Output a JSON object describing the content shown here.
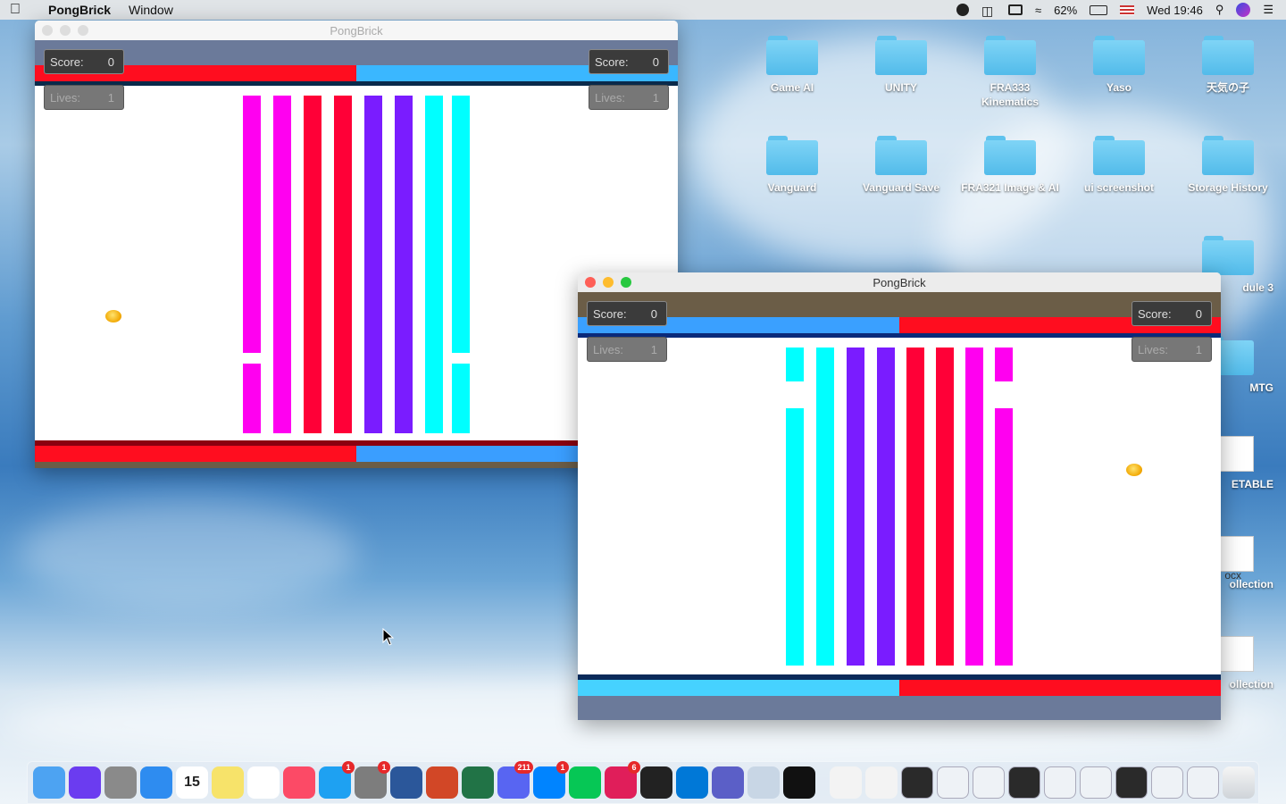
{
  "menubar": {
    "app_name": "PongBrick",
    "menus": [
      "Window"
    ],
    "battery": "62%",
    "clock": "Wed 19:46"
  },
  "desktop_icons": [
    {
      "label": "Game AI",
      "kind": "folder"
    },
    {
      "label": "UNITY",
      "kind": "folder"
    },
    {
      "label": "FRA333 Kinematics",
      "kind": "folder"
    },
    {
      "label": "Yaso",
      "kind": "folder"
    },
    {
      "label": "天気の子",
      "kind": "folder"
    },
    {
      "label": "Vanguard",
      "kind": "folder"
    },
    {
      "label": "Vanguard Save",
      "kind": "folder"
    },
    {
      "label": "FRA321 Image & AI",
      "kind": "folder"
    },
    {
      "label": "ui screenshot",
      "kind": "folder"
    },
    {
      "label": "Storage History",
      "kind": "folder"
    },
    {
      "label": "dule 3",
      "kind": "folder-partial"
    },
    {
      "label": "MTG",
      "kind": "folder-partial"
    },
    {
      "label": "ETABLE",
      "kind": "file-partial"
    },
    {
      "label": "ollection",
      "kind": "file-partial"
    },
    {
      "label": "ollection",
      "kind": "file-partial"
    },
    {
      "label": "ocx",
      "kind": "file-partial"
    }
  ],
  "window_back": {
    "title": "PongBrick",
    "p1": {
      "score_label": "Score:",
      "score": "0",
      "lives_label": "Lives:",
      "lives": "1"
    },
    "p2": {
      "score_label": "Score:",
      "score": "0",
      "lives_label": "Lives:",
      "lives": "1"
    }
  },
  "window_front": {
    "title": "PongBrick",
    "p1": {
      "score_label": "Score:",
      "score": "0",
      "lives_label": "Lives:",
      "lives": "1"
    },
    "p2": {
      "score_label": "Score:",
      "score": "0",
      "lives_label": "Lives:",
      "lives": "1"
    }
  },
  "colors": {
    "red": "#ff0033",
    "magenta": "#ff00ee",
    "violet": "#7a1cff",
    "cyan": "#00ffff",
    "blue": "#3aa0ff",
    "hud": "#6a5a44"
  },
  "dock": {
    "items": [
      {
        "name": "finder-icon",
        "badge": ""
      },
      {
        "name": "siri-icon",
        "badge": ""
      },
      {
        "name": "launchpad-icon",
        "badge": ""
      },
      {
        "name": "safari-icon",
        "badge": ""
      },
      {
        "name": "calendar-icon",
        "badge": "",
        "text": "15"
      },
      {
        "name": "notes-icon",
        "badge": ""
      },
      {
        "name": "reminders-icon",
        "badge": ""
      },
      {
        "name": "music-icon",
        "badge": ""
      },
      {
        "name": "app-store-icon",
        "badge": "1"
      },
      {
        "name": "system-preferences-icon",
        "badge": "1"
      },
      {
        "name": "word-icon",
        "badge": ""
      },
      {
        "name": "powerpoint-icon",
        "badge": ""
      },
      {
        "name": "excel-icon",
        "badge": ""
      },
      {
        "name": "discord-icon",
        "badge": "211"
      },
      {
        "name": "messenger-icon",
        "badge": "1"
      },
      {
        "name": "line-icon",
        "badge": ""
      },
      {
        "name": "slack-icon",
        "badge": "6"
      },
      {
        "name": "unity-hub-icon",
        "badge": ""
      },
      {
        "name": "vscode-icon",
        "badge": ""
      },
      {
        "name": "teams-icon",
        "badge": ""
      },
      {
        "name": "preview-icon",
        "badge": ""
      },
      {
        "name": "unity-icon",
        "badge": ""
      },
      {
        "name": "text-edit-icon",
        "badge": ""
      },
      {
        "name": "text-edit-2-icon",
        "badge": ""
      }
    ]
  }
}
